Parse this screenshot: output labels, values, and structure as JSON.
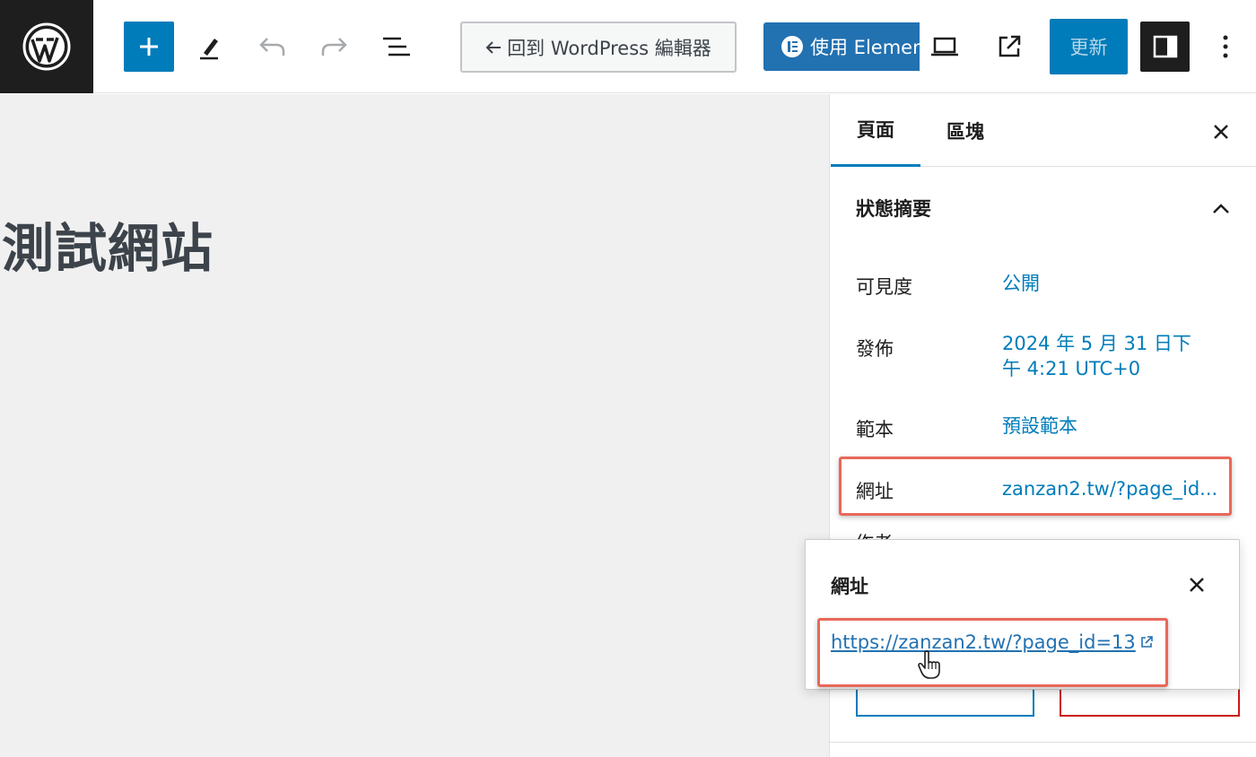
{
  "topbar": {
    "back_label": "回到 WordPress 編輯器",
    "elementor_label": "使用 Elementor",
    "update_label": "更新"
  },
  "canvas": {
    "title": "測試網站"
  },
  "sidebar": {
    "tabs": [
      {
        "label": "頁面"
      },
      {
        "label": "區塊"
      }
    ],
    "panel_title": "狀態摘要",
    "rows": {
      "visibility": {
        "label": "可見度",
        "value": "公開"
      },
      "publish": {
        "label": "發佈",
        "value_line1": "2024 年 5 月 31 日下",
        "value_line2": "午 4:21 UTC+0"
      },
      "template": {
        "label": "範本",
        "value": "預設範本"
      },
      "url": {
        "label": "網址",
        "value": "zanzan2.tw/?page_id..."
      },
      "author": {
        "label": "作者"
      }
    }
  },
  "popover": {
    "title": "網址",
    "link": "https://zanzan2.tw/?page_id=13"
  },
  "colors": {
    "accent": "#007cba",
    "highlight": "#e8685a",
    "dark": "#1e1e1e",
    "canvas_bg": "#f0f0f0"
  }
}
